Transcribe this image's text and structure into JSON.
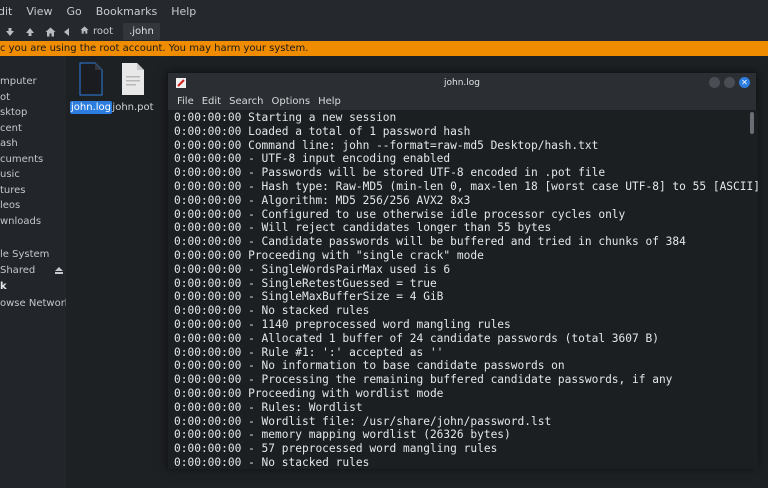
{
  "menubar": {
    "items": [
      "dit",
      "View",
      "Go",
      "Bookmarks",
      "Help"
    ]
  },
  "toolbar": {
    "crumbs": [
      "root",
      ".john"
    ]
  },
  "warning": "c you are using the root account. You may harm your system.",
  "sidebar": {
    "items": [
      "mputer",
      "ot",
      "sktop",
      "cent",
      "ash",
      "cuments",
      "usic",
      "tures",
      "leos",
      "wnloads",
      "le System",
      "Shared",
      "k",
      "owse Network"
    ]
  },
  "files": [
    {
      "name": "john.log",
      "selected": true
    },
    {
      "name": "john.pot",
      "selected": false
    }
  ],
  "terminal": {
    "title": "john.log",
    "menu": [
      "File",
      "Edit",
      "Search",
      "Options",
      "Help"
    ],
    "lines": [
      "0:00:00:00 Starting a new session",
      "0:00:00:00 Loaded a total of 1 password hash",
      "0:00:00:00 Command line: john --format=raw-md5 Desktop/hash.txt",
      "0:00:00:00 - UTF-8 input encoding enabled",
      "0:00:00:00 - Passwords will be stored UTF-8 encoded in .pot file",
      "0:00:00:00 - Hash type: Raw-MD5 (min-len 0, max-len 18 [worst case UTF-8] to 55 [ASCII])",
      "0:00:00:00 - Algorithm: MD5 256/256 AVX2 8x3",
      "0:00:00:00 - Configured to use otherwise idle processor cycles only",
      "0:00:00:00 - Will reject candidates longer than 55 bytes",
      "0:00:00:00 - Candidate passwords will be buffered and tried in chunks of 384",
      "0:00:00:00 Proceeding with \"single crack\" mode",
      "0:00:00:00 - SingleWordsPairMax used is 6",
      "0:00:00:00 - SingleRetestGuessed = true",
      "0:00:00:00 - SingleMaxBufferSize = 4 GiB",
      "0:00:00:00 - No stacked rules",
      "0:00:00:00 - 1140 preprocessed word mangling rules",
      "0:00:00:00 - Allocated 1 buffer of 24 candidate passwords (total 3607 B)",
      "0:00:00:00 - Rule #1: ':' accepted as ''",
      "0:00:00:00 - No information to base candidate passwords on",
      "0:00:00:00 - Processing the remaining buffered candidate passwords, if any",
      "0:00:00:00 Proceeding with wordlist mode",
      "0:00:00:00 - Rules: Wordlist",
      "0:00:00:00 - Wordlist file: /usr/share/john/password.lst",
      "0:00:00:00 - memory mapping wordlist (26326 bytes)",
      "0:00:00:00 - 57 preprocessed word mangling rules",
      "0:00:00:00 - No stacked rules"
    ]
  }
}
